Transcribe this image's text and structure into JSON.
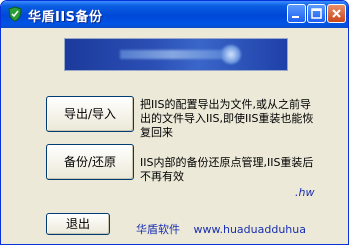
{
  "window": {
    "title": "华盾IIS备份",
    "title_bar_color": "#0054e6",
    "controls": [
      "minimize-icon",
      "maximize-icon",
      "close-icon"
    ]
  },
  "actions": {
    "export_import_label": "导出/导入",
    "export_import_desc": "把IIS的配置导出为文件,或从之前导出的文件导入IIS,即使IIS重装也能恢复回来",
    "backup_restore_label": "备份/还原",
    "backup_restore_desc": "IIS内部的备份还原点管理,IIS重装后不再有效"
  },
  "fragment": ".hw",
  "footer": {
    "company": "华盾软件",
    "website": "www.huaduadduhua"
  },
  "exit_label": "退出"
}
